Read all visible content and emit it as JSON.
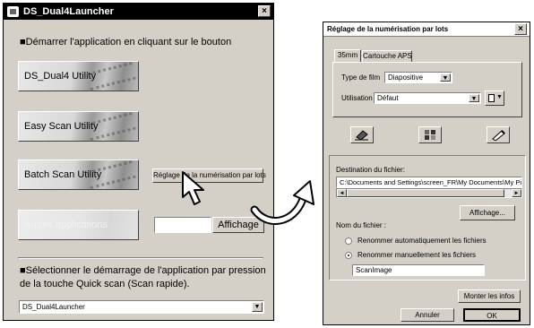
{
  "launcher": {
    "title": "DS_Dual4Launcher",
    "close": "×",
    "intro": "■Démarrer l'application en cliquant sur le bouton",
    "buttons": [
      "DS_Dual4 Utility",
      "Easy Scan Utility",
      "Batch Scan Utility",
      "Autres applications"
    ],
    "batch_settings_label": "Réglage de la numérisation par lots",
    "display_button": "Affichage",
    "quickscan_text_1": "■Sélectionner le démarrage de l'application par pression",
    "quickscan_text_2": "de la touche Quick scan (Scan rapide).",
    "quickscan_value": "DS_Dual4Launcher",
    "dropdown_arrow": "▼"
  },
  "dialog": {
    "title": "Réglage de la numérisation par lots",
    "close": "×",
    "tabs": [
      "35mm",
      "Cartouche APS"
    ],
    "film_type_label": "Type de film",
    "film_type_value": "Diapositive",
    "usage_label": "Utilisation",
    "usage_value": "Défaut",
    "destination_label": "Destination du fichier:",
    "destination_path": "C:\\Documents and Settings\\screen_FR\\My Documents\\My Pi",
    "scroll_left": "◄",
    "scroll_right": "►",
    "browse_button": "Affichage...",
    "filename_label": "Nom du fichier :",
    "radio_auto": "Renommer automatiquement les fichiers",
    "radio_manual": "Renommer manuellement les fichiers",
    "filename_value": "ScanImage",
    "show_info_button": "Monter les infos",
    "cancel_button": "Annuler",
    "ok_button": "OK"
  }
}
